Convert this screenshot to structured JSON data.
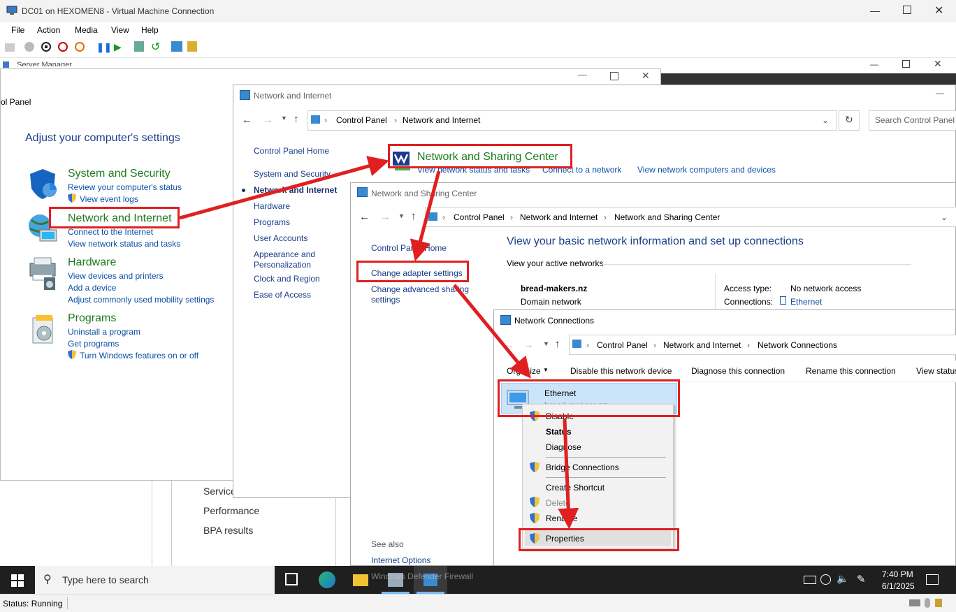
{
  "vm": {
    "title": "DC01 on HEXOMEN8 - Virtual Machine Connection",
    "menu": [
      "File",
      "Action",
      "Media",
      "View",
      "Help"
    ],
    "status": "Status: Running"
  },
  "server_manager": {
    "title": "Server Manager",
    "items": [
      "Service",
      "Performance",
      "BPA results"
    ]
  },
  "control_panel": {
    "title_partial": "ol Panel",
    "heading": "Adjust your computer's settings",
    "categories": [
      {
        "title": "System and Security",
        "links": [
          "Review your computer's status",
          "View event logs"
        ]
      },
      {
        "title": "Network and Internet",
        "links": [
          "Connect to the Internet",
          "View network status and tasks"
        ]
      },
      {
        "title": "Hardware",
        "links": [
          "View devices and printers",
          "Add a device",
          "Adjust commonly used mobility settings"
        ]
      },
      {
        "title": "Programs",
        "links": [
          "Uninstall a program",
          "Get programs",
          "Turn Windows features on or off"
        ]
      }
    ]
  },
  "net_internet": {
    "title": "Network and Internet",
    "crumbs": [
      "Control Panel",
      "Network and Internet"
    ],
    "search_placeholder": "Search Control Panel",
    "nav": [
      "Control Panel Home",
      "System and Security",
      "Network and Internet",
      "Hardware",
      "Programs",
      "User Accounts",
      "Appearance and Personalization",
      "Clock and Region",
      "Ease of Access"
    ],
    "nsc_title": "Network and Sharing Center",
    "nsc_links": [
      "View network status and tasks",
      "Connect to a network",
      "View network computers and devices"
    ]
  },
  "nsc": {
    "title": "Network and Sharing Center",
    "crumbs": [
      "Control Panel",
      "Network and Internet",
      "Network and Sharing Center"
    ],
    "left_links": [
      "Control Panel Home",
      "Change adapter settings",
      "Change advanced sharing settings"
    ],
    "heading": "View your basic network information and set up connections",
    "active_label": "View your active networks",
    "network_name": "bread-makers.nz",
    "network_type": "Domain network",
    "access_label": "Access type:",
    "access_value": "No network access",
    "connections_label": "Connections:",
    "connections_value": "Ethernet",
    "see_also": "See also",
    "see_also_links": [
      "Internet Options",
      "Windows Defender Firewall"
    ]
  },
  "netconn": {
    "title": "Network Connections",
    "crumbs": [
      "Control Panel",
      "Network and Internet",
      "Network Connections"
    ],
    "toolbar": [
      "Organize",
      "Disable this network device",
      "Diagnose this connection",
      "Rename this connection",
      "View status"
    ],
    "adapter_name": "Ethernet",
    "adapter_sub": "bread-makers.nz",
    "context_menu": [
      "Disable",
      "Status",
      "Diagnose",
      "Bridge Connections",
      "Create Shortcut",
      "Delete",
      "Rename",
      "Properties"
    ]
  },
  "taskbar": {
    "search_placeholder": "Type here to search",
    "time": "7:40 PM",
    "date": "6/1/2025"
  }
}
